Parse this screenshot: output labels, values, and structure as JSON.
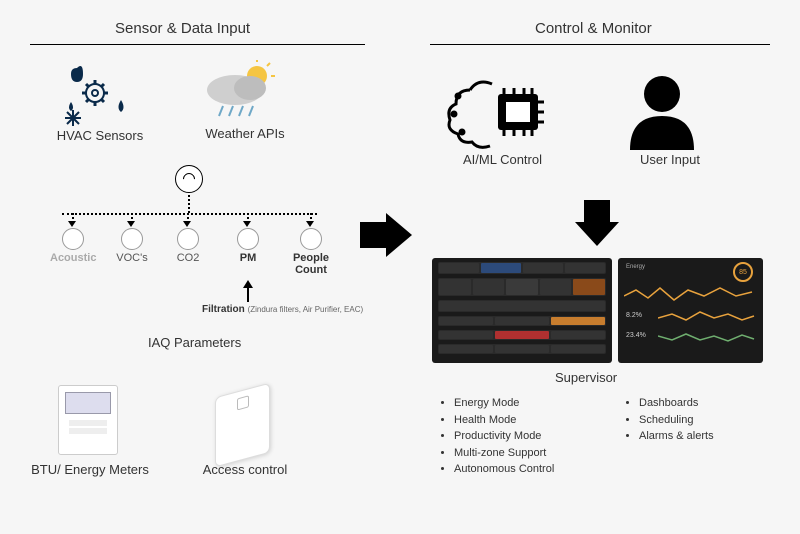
{
  "sections": {
    "left_title": "Sensor & Data Input",
    "right_title": "Control & Monitor"
  },
  "input_nodes": {
    "hvac": "HVAC Sensors",
    "weather": "Weather APIs",
    "btu": "BTU/ Energy Meters",
    "access": "Access control"
  },
  "iaq": {
    "title": "IAQ Parameters",
    "params": [
      "Acoustic",
      "VOC's",
      "CO2",
      "PM",
      "People Count"
    ],
    "filtration_label": "Filtration",
    "filtration_sub": "(Zindura filters, Air Purifier, EAC)"
  },
  "control_nodes": {
    "ai": "AI/ML Control",
    "user": "User Input",
    "supervisor": "Supervisor"
  },
  "supervisor_features": {
    "col1": [
      "Energy Mode",
      "Health Mode",
      "Productivity Mode",
      "Multi-zone Support",
      "Autonomous Control"
    ],
    "col2": [
      "Dashboards",
      "Scheduling",
      "Alarms & alerts"
    ]
  }
}
